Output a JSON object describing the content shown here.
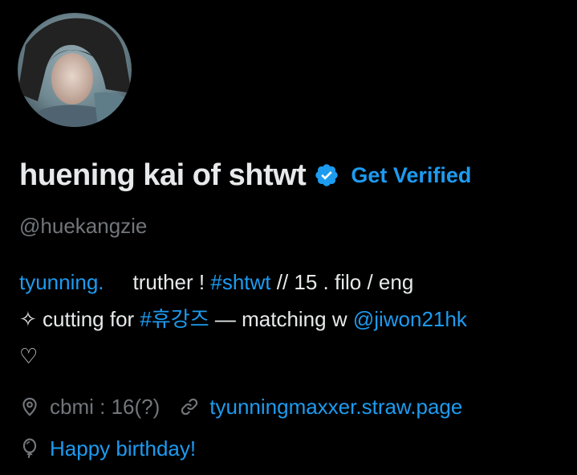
{
  "profile": {
    "display_name": "huening kai of shtwt",
    "verified_badge": "verified-badge-icon",
    "get_verified_label": "Get Verified",
    "handle": "@huekangzie"
  },
  "bio": {
    "line1": {
      "part1": "tyunning.",
      "part2": "truther ! ",
      "hashtag1": "#shtwt",
      "part3": " // 15 . filo / eng"
    },
    "line2": {
      "symbol": "✧",
      "part1": " cutting for ",
      "hashtag2": "#휴강즈",
      "part2": " — matching w ",
      "mention": "@jiwon21hk"
    },
    "line3": {
      "heart": "♡"
    }
  },
  "meta": {
    "location": "cbmi : 16(?)",
    "website": "tyunningmaxxer.straw.page",
    "birthday": "Happy birthday!"
  },
  "colors": {
    "background": "#000000",
    "text": "#e7e9ea",
    "muted": "#71767b",
    "accent": "#1d9bf0"
  }
}
